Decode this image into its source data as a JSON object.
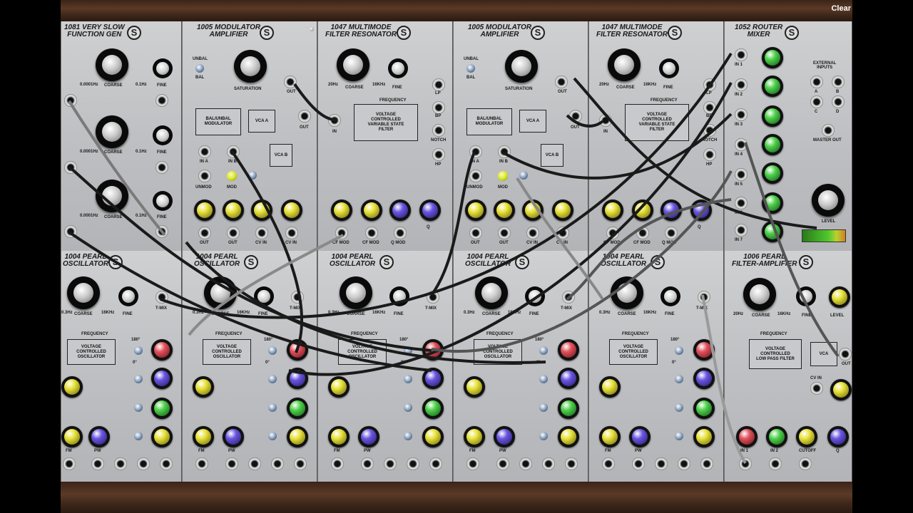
{
  "toolbar": {
    "clear_label": "Clear"
  },
  "modules_row1": [
    {
      "title": "1081 VERY SLOW\nFUNCTION GEN",
      "labels": [
        "COARSE",
        "FINE",
        "0.0001Hz",
        "0.1Hz",
        "COARSE",
        "FINE",
        "0.0001Hz",
        "0.1Hz",
        "COARSE",
        "FINE",
        "0.0001Hz",
        "0.1Hz"
      ]
    },
    {
      "title": "1005 MODULATOR\nAMPLIFIER",
      "labels": [
        "UNBAL",
        "BAL",
        "SATURATION",
        "OUT",
        "OUT",
        "IN A",
        "IN B",
        "UNMOD",
        "MOD",
        "OUT",
        "OUT",
        "CV IN",
        "CV IN"
      ],
      "blocks": [
        "BAL/UNBAL\nMODULATOR",
        "VCA A",
        "VCA B"
      ]
    },
    {
      "title": "1047 MULTIMODE\nFILTER RESONATOR",
      "labels": [
        "COARSE",
        "FINE",
        "20Hz",
        "16KHz",
        "FREQUENCY",
        "IN",
        "LP",
        "BP",
        "NOTCH",
        "HP",
        "CF MOD",
        "CF MOD",
        "Q MOD",
        "Q"
      ],
      "blocks": [
        "VOLTAGE\nCONTROLLED\nVARIABLE STATE\nFILTER"
      ]
    },
    {
      "title": "1005 MODULATOR\nAMPLIFIER",
      "labels": [
        "UNBAL",
        "BAL",
        "SATURATION",
        "OUT",
        "OUT",
        "IN A",
        "IN B",
        "UNMOD",
        "MOD",
        "OUT",
        "OUT",
        "CV IN",
        "CV IN"
      ],
      "blocks": [
        "BAL/UNBAL\nMODULATOR",
        "VCA A",
        "VCA B"
      ]
    },
    {
      "title": "1047 MULTIMODE\nFILTER RESONATOR",
      "labels": [
        "COARSE",
        "FINE",
        "20Hz",
        "16KHz",
        "FREQUENCY",
        "IN",
        "LP",
        "BP",
        "NOTCH",
        "HP",
        "CF MOD",
        "CF MOD",
        "Q MOD",
        "Q"
      ],
      "blocks": [
        "VOLTAGE\nCONTROLLED\nVARIABLE STATE\nFILTER"
      ]
    },
    {
      "title": "1052 ROUTER\nMIXER",
      "labels": [
        "IN 1",
        "IN 2",
        "IN 3",
        "IN 4",
        "IN 5",
        "IN 6",
        "IN 7",
        "EXTERNAL\nINPUTS",
        "A",
        "B",
        "C",
        "D",
        "MASTER OUT",
        "LEVEL"
      ]
    }
  ],
  "modules_row2": [
    {
      "title": "1004 PEARL\nOSCILLATOR",
      "labels": [
        "COARSE",
        "FINE",
        "0.3Hz",
        "16KHz",
        "T-MIX",
        "FREQUENCY",
        "180°",
        "0°",
        "FM",
        "PW"
      ],
      "blocks": [
        "VOLTAGE\nCONTROLLED\nOSCILLATOR"
      ]
    },
    {
      "title": "1004 PEARL\nOSCILLATOR",
      "labels": [
        "COARSE",
        "FINE",
        "0.3Hz",
        "16KHz",
        "T-MIX",
        "FREQUENCY",
        "180°",
        "0°",
        "FM",
        "PW"
      ],
      "blocks": [
        "VOLTAGE\nCONTROLLED\nOSCILLATOR"
      ]
    },
    {
      "title": "1004 PEARL\nOSCILLATOR",
      "labels": [
        "COARSE",
        "FINE",
        "0.3Hz",
        "16KHz",
        "T-MIX",
        "FREQUENCY",
        "180°",
        "0°",
        "FM",
        "PW"
      ],
      "blocks": [
        "VOLTAGE\nCONTROLLED\nOSCILLATOR"
      ]
    },
    {
      "title": "1004 PEARL\nOSCILLATOR",
      "labels": [
        "COARSE",
        "FINE",
        "0.3Hz",
        "16KHz",
        "T-MIX",
        "FREQUENCY",
        "180°",
        "0°",
        "FM",
        "PW"
      ],
      "blocks": [
        "VOLTAGE\nCONTROLLED\nOSCILLATOR"
      ]
    },
    {
      "title": "1004 PEARL\nOSCILLATOR",
      "labels": [
        "COARSE",
        "FINE",
        "0.3Hz",
        "16KHz",
        "T-MIX",
        "FREQUENCY",
        "180°",
        "0°",
        "FM",
        "PW"
      ],
      "blocks": [
        "VOLTAGE\nCONTROLLED\nOSCILLATOR"
      ]
    },
    {
      "title": "1006 PEARL\nFILTER-AMPLIFIER",
      "labels": [
        "COARSE",
        "FINE",
        "20Hz",
        "16KHz",
        "LEVEL",
        "FREQUENCY",
        "CV IN",
        "OUT",
        "IN 1",
        "IN 2",
        "CUTOFF",
        "Q"
      ],
      "blocks": [
        "VOLTAGE\nCONTROLLED\nLOW PASS FILTER",
        "VCA"
      ]
    }
  ],
  "colors": {
    "yellow": "#e8e23a",
    "purple": "#6a55e0",
    "green": "#4ed14a",
    "red": "#e0525c",
    "panel": "#c4c5c8",
    "wood": "#4a2e1e"
  }
}
